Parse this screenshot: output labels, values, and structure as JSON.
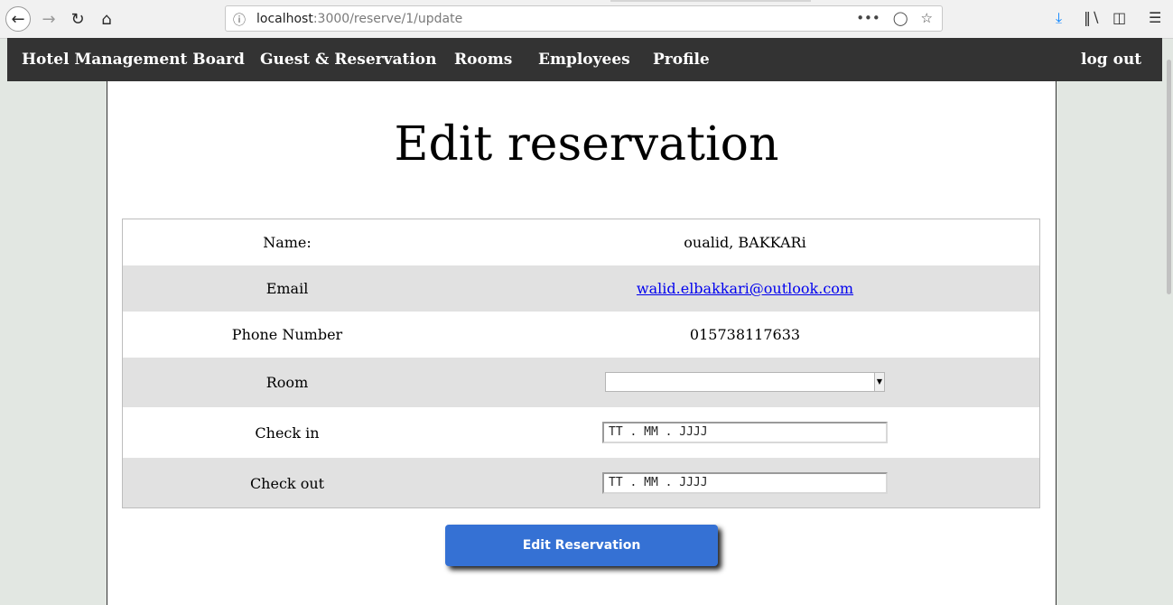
{
  "browser": {
    "url_host": "localhost",
    "url_path": ":3000/reserve/1/update",
    "icons": [
      "back-icon",
      "forward-icon",
      "reload-icon",
      "home-icon",
      "info-icon",
      "more-icon",
      "pocket-icon",
      "bookmark-star-icon",
      "download-icon",
      "library-icon",
      "sidebar-icon",
      "menu-icon"
    ]
  },
  "navbar": {
    "brand": "Hotel Management Board",
    "items": [
      "Guest & Reservation",
      "Rooms",
      "Employees",
      "Profile"
    ],
    "logout": "log out",
    "bg_color": "#333333"
  },
  "page": {
    "title": "Edit reservation"
  },
  "form": {
    "name_label": "Name:",
    "name_value": "oualid, BAKKARi",
    "email_label": "Email",
    "email_value": "walid.elbakkari@outlook.com",
    "phone_label": "Phone Number",
    "phone_value": "015738117633",
    "room_label": "Room",
    "room_value": "",
    "checkin_label": "Check in",
    "checkin_value": "TT . MM . JJJJ",
    "checkout_label": "Check out",
    "checkout_value": "TT . MM . JJJJ",
    "submit_label": "Edit Reservation",
    "submit_color": "#3571d4"
  }
}
